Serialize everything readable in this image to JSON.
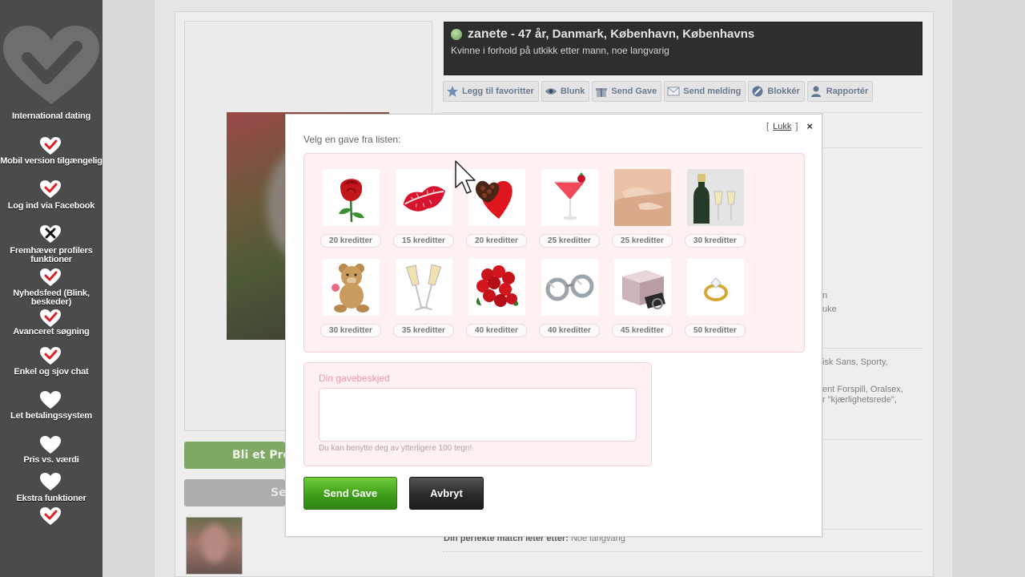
{
  "sidebar": {
    "features": [
      {
        "label": "International dating",
        "status": "yes"
      },
      {
        "label": "Mobil version tilgængelig",
        "status": "yes"
      },
      {
        "label": "Log ind via Facebook",
        "status": "yes"
      },
      {
        "label": "Fremhæver profilers funktioner",
        "status": "no"
      },
      {
        "label": "Nyhedsfeed (Blink, beskeder)",
        "status": "yes"
      },
      {
        "label": "Avanceret søgning",
        "status": "yes"
      },
      {
        "label": "Enkel og sjov chat",
        "status": "yes"
      },
      {
        "label": "Let betalingssystem",
        "status": "neutral"
      },
      {
        "label": "Pris vs. værdi",
        "status": "neutral"
      },
      {
        "label": "Ekstra funktioner",
        "status": "neutral"
      }
    ],
    "check_color": "#d9222a"
  },
  "profile": {
    "nickname": "zanete",
    "details": " - 47 år, Danmark, København, Københavns",
    "status_line": "Kvinne i forhold på utkikk etter mann, noe langvarig",
    "premium_button": "Bli et Prem",
    "secondary_button": "Se",
    "match_label": "Din perfekte match leter etter:",
    "match_value": "Noe langvarig",
    "right_fragments": [
      "n",
      "uke",
      "isk Sans, Sporty,",
      "ent Forspill, Oralsex,",
      "r \"kjærlighetsrede\","
    ]
  },
  "toolbar": [
    {
      "label": "Legg til favoritter",
      "icon": "star-icon"
    },
    {
      "label": "Blunk",
      "icon": "eye-icon"
    },
    {
      "label": "Send Gave",
      "icon": "gift-icon"
    },
    {
      "label": "Send melding",
      "icon": "envelope-icon"
    },
    {
      "label": "Blokkér",
      "icon": "block-icon"
    },
    {
      "label": "Rapportér",
      "icon": "report-icon"
    }
  ],
  "modal": {
    "close_label": "Lukk",
    "close_bracket_open": "[",
    "close_bracket_close": "]",
    "close_x": "×",
    "title": "Velg en gave fra listen:",
    "gifts": [
      {
        "name": "rose",
        "price": "20 kreditter"
      },
      {
        "name": "kiss-lips",
        "price": "15 kreditter"
      },
      {
        "name": "heart-chocolates",
        "price": "20 kreditter"
      },
      {
        "name": "cocktail",
        "price": "25 kreditter"
      },
      {
        "name": "massage",
        "price": "25 kreditter"
      },
      {
        "name": "champagne-bottle",
        "price": "30 kreditter"
      },
      {
        "name": "teddy-bear",
        "price": "30 kreditter"
      },
      {
        "name": "champagne-glasses",
        "price": "35 kreditter"
      },
      {
        "name": "rose-bouquet",
        "price": "40 kreditter"
      },
      {
        "name": "handcuffs",
        "price": "40 kreditter"
      },
      {
        "name": "gift-box",
        "price": "45 kreditter"
      },
      {
        "name": "ring",
        "price": "50 kreditter"
      }
    ],
    "message_label": "Din gavebeskjed",
    "message_value": "",
    "message_hint": "Du kan benytte deg av ytterligere 100 tegn!",
    "send_button": "Send Gave",
    "cancel_button": "Avbryt"
  },
  "colors": {
    "send_green": "#3f9e1a",
    "panel_pink": "#fff0f2",
    "label_pink": "#e89aa6",
    "sidebar_bg": "#4b4b4b"
  }
}
